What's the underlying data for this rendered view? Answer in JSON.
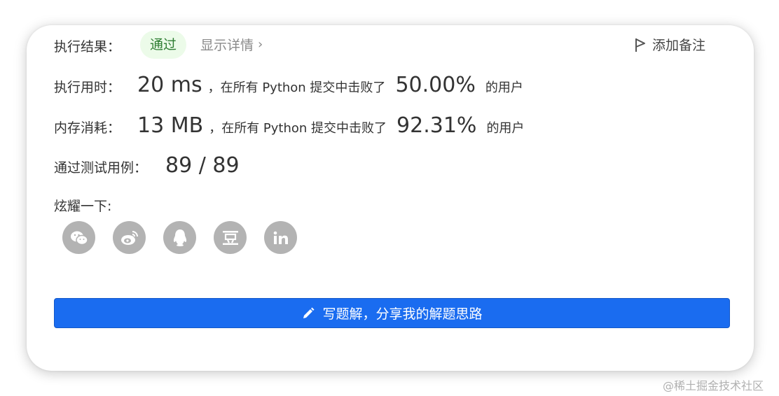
{
  "result": {
    "label": "执行结果：",
    "status": "通过",
    "details_link": "显示详情",
    "details_chevron": "›",
    "add_note": "添加备注"
  },
  "runtime": {
    "label": "执行用时：",
    "value": "20 ms",
    "middle": "，在所有 Python 提交中击败了",
    "percent": "50.00%",
    "suffix": "的用户"
  },
  "memory": {
    "label": "内存消耗：",
    "value": "13 MB",
    "middle": "，在所有 Python 提交中击败了",
    "percent": "92.31%",
    "suffix": "的用户"
  },
  "testcases": {
    "label": "通过测试用例：",
    "value": "89 / 89"
  },
  "share": {
    "label": "炫耀一下:",
    "icons": [
      "wechat-icon",
      "weibo-icon",
      "qq-icon",
      "douban-icon",
      "linkedin-icon"
    ]
  },
  "cta": {
    "label": "写题解，分享我的解题思路"
  },
  "watermark": "@稀土掘金技术社区",
  "colors": {
    "accent": "#1a6cf0",
    "success_bg": "#ecfbe9",
    "success_text": "#2e7d32",
    "icon_gray": "#b3b3b3"
  }
}
